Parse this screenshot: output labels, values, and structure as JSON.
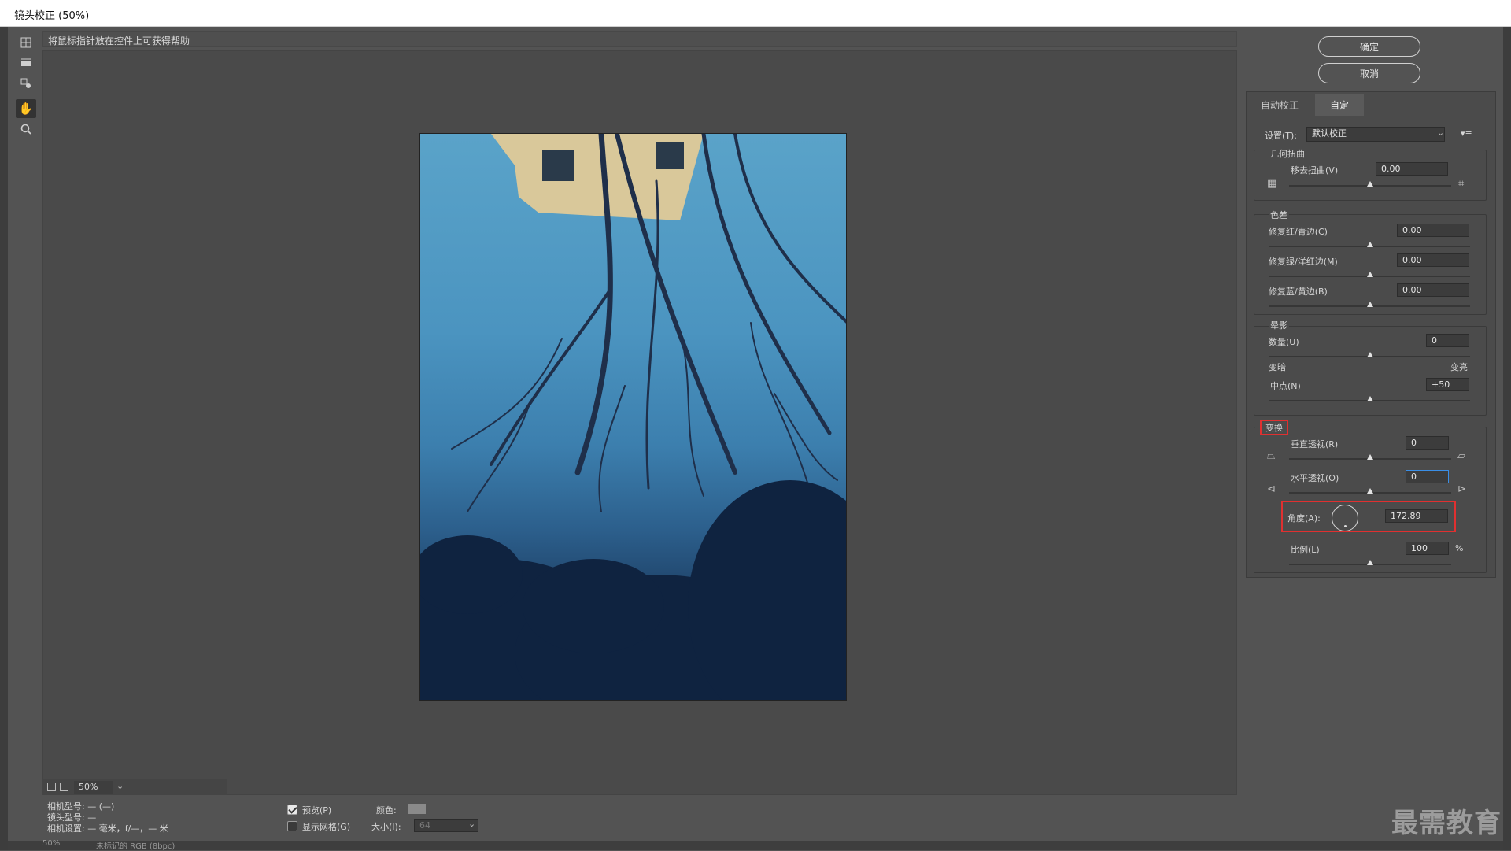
{
  "window": {
    "title": "镜头校正 (50%)"
  },
  "help_text": "将鼠标指针放在控件上可获得帮助",
  "buttons": {
    "ok": "确定",
    "cancel": "取消"
  },
  "tabs": [
    "自动校正",
    "自定"
  ],
  "settings": {
    "label": "设置(T):",
    "value": "默认校正"
  },
  "geometric": {
    "title": "几何扭曲",
    "remove_label": "移去扭曲(V)",
    "remove_value": "0.00"
  },
  "chromatic": {
    "title": "色差",
    "red_label": "修复红/青边(C)",
    "red_value": "0.00",
    "green_label": "修复绿/洋红边(M)",
    "green_value": "0.00",
    "blue_label": "修复蓝/黄边(B)",
    "blue_value": "0.00"
  },
  "vignette": {
    "title": "晕影",
    "amount_label": "数量(U)",
    "amount_value": "0",
    "darken": "变暗",
    "lighten": "变亮",
    "midpoint_label": "中点(N)",
    "midpoint_value": "+50"
  },
  "transform": {
    "title": "变换",
    "vertical_label": "垂直透视(R)",
    "vertical_value": "0",
    "horizontal_label": "水平透视(O)",
    "horizontal_value": "0",
    "angle_label": "角度(A):",
    "angle_value": "172.89",
    "scale_label": "比例(L)",
    "scale_value": "100",
    "scale_unit": "%"
  },
  "zoom": {
    "value": "50%"
  },
  "info": {
    "camera": "相机型号: — (—)",
    "lens": "镜头型号: —",
    "settings": "相机设置: — 毫米，f/—，— 米"
  },
  "preview": {
    "label": "预览(P)",
    "checked": true
  },
  "grid": {
    "label": "显示网格(G)",
    "checked": false,
    "color_label": "颜色:",
    "size_label": "大小(I):",
    "size_value": "64"
  },
  "status": {
    "zoom": "50%",
    "doc": "未标记的 RGB (8bpc)"
  },
  "watermark": "最需教育",
  "colors": {
    "accent_red": "#e03030",
    "panel": "#4b4b4b",
    "background": "#535353"
  }
}
